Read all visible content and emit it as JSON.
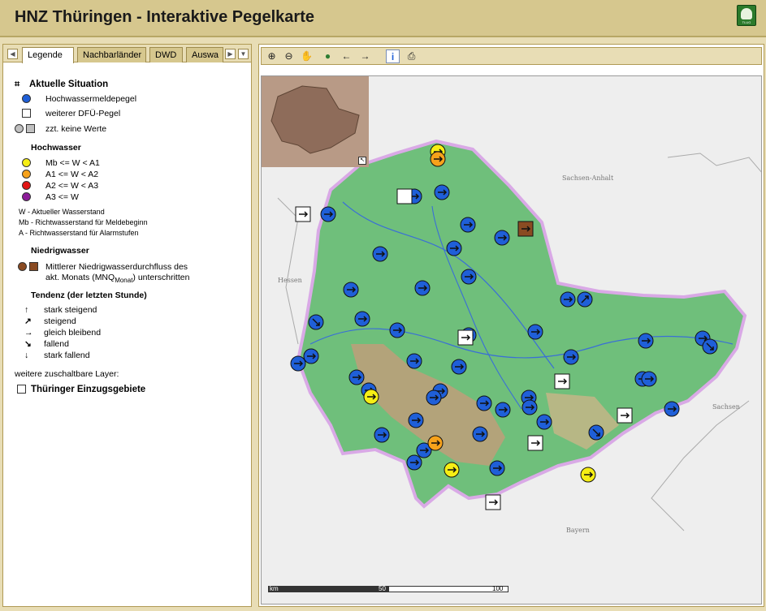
{
  "header": {
    "title": "HNZ Thüringen - Interaktive Pegelkarte",
    "logo_text": "TLUG"
  },
  "tabs": {
    "items": [
      {
        "label": "Legende",
        "active": true
      },
      {
        "label": "Nachbarländer",
        "active": false
      },
      {
        "label": "DWD",
        "active": false
      },
      {
        "label": "Auswa",
        "active": false
      }
    ]
  },
  "legend": {
    "section_title": "Aktuelle Situation",
    "hw_gauge": "Hochwassermeldepegel",
    "dfu_gauge": "weiterer DFÜ-Pegel",
    "no_values": "zzt. keine Werte",
    "hochwasser_title": "Hochwasser",
    "levels": [
      {
        "text": "Mb <= W < A1",
        "color": "#f6ee15"
      },
      {
        "text": "A1  <= W < A2",
        "color": "#f7a21b"
      },
      {
        "text": "A2  <= W < A3",
        "color": "#e21414"
      },
      {
        "text": "A3  <= W",
        "color": "#8c1c99"
      }
    ],
    "abbr": [
      "W  - Aktueller Wasserstand",
      "Mb - Richtwasserstand für Meldebeginn",
      "A  - Richtwasserstand für Alarmstufen"
    ],
    "niedrig_title": "Niedrigwasser",
    "niedrig_line1": "Mittlerer Niedrigwasserdurchfluss des",
    "niedrig_line2_pre": "akt. Monats (MNQ",
    "niedrig_sub": "Monat",
    "niedrig_line2_post": ") unterschritten",
    "tendenz_title": "Tendenz (der letzten Stunde)",
    "tendenz": [
      {
        "symbol": "↑",
        "text": "stark steigend"
      },
      {
        "symbol": "↗",
        "text": "steigend"
      },
      {
        "symbol": "→",
        "text": "gleich bleibend"
      },
      {
        "symbol": "↘",
        "text": "fallend"
      },
      {
        "symbol": "↓",
        "text": "stark fallend"
      }
    ],
    "more_layers": "weitere zuschaltbare Layer:",
    "layer_einzug": "Thüringer Einzugsgebiete"
  },
  "toolbar": {
    "tools": [
      "zoom-in-icon",
      "zoom-out-icon",
      "pan-icon",
      "globe-icon",
      "back-arrow-icon",
      "forward-arrow-icon",
      "info-icon",
      "print-icon"
    ]
  },
  "map": {
    "neighbors": [
      "Sachsen-Anhalt",
      "Hessen",
      "Sachsen",
      "Bayern"
    ],
    "scale_labels": [
      "km",
      "50",
      "100"
    ]
  },
  "colors": {
    "blue": "#1f5fd8",
    "yellow": "#f6ee15",
    "orange": "#f7a21b",
    "red": "#e21414",
    "purple": "#8c1c99",
    "brown": "#8a4b22"
  }
}
